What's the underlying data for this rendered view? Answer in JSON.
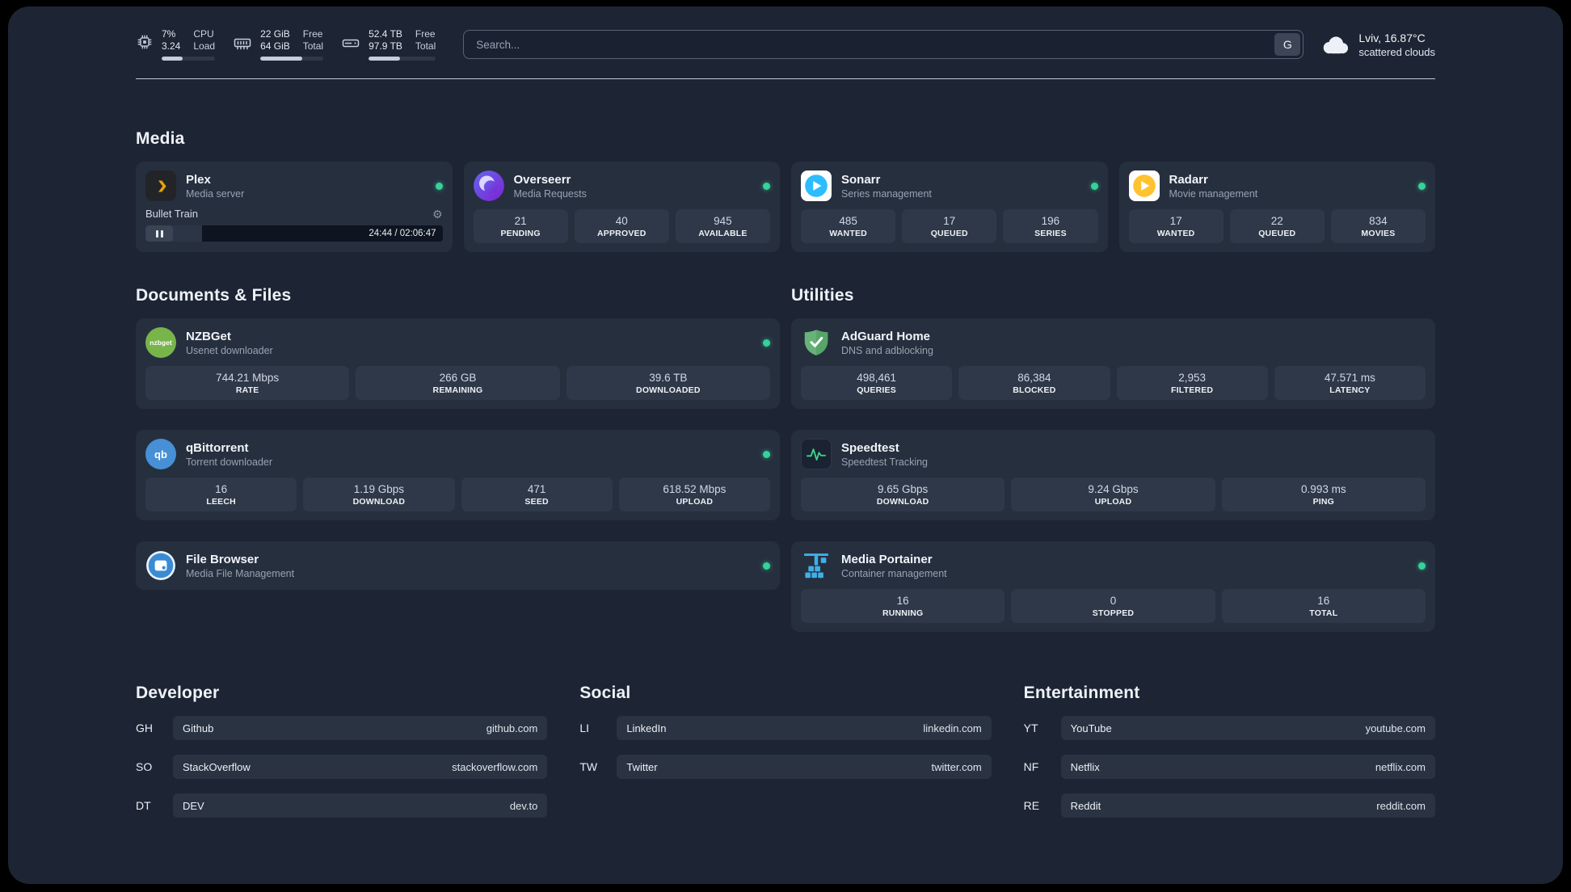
{
  "topbar": {
    "cpu": {
      "value_top": "7%",
      "value_bottom": "3.24",
      "label_top": "CPU",
      "label_bottom": "Load",
      "bar": "40%"
    },
    "memory": {
      "value_top": "22 GiB",
      "value_bottom": "64 GiB",
      "label_top": "Free",
      "label_bottom": "Total",
      "bar": "66%"
    },
    "disk": {
      "value_top": "52.4 TB",
      "value_bottom": "97.9 TB",
      "label_top": "Free",
      "label_bottom": "Total",
      "bar": "47%"
    },
    "search": {
      "placeholder": "Search...",
      "provider_label": "G"
    },
    "weather": {
      "location": "Lviv, 16.87°C",
      "condition": "scattered clouds"
    }
  },
  "sections": {
    "media": {
      "title": "Media",
      "plex": {
        "name": "Plex",
        "subtitle": "Media server",
        "player": {
          "track": "Bullet Train",
          "time": "24:44 / 02:06:47",
          "progress": "19%"
        }
      },
      "overseerr": {
        "name": "Overseerr",
        "subtitle": "Media Requests",
        "stats": [
          {
            "value": "21",
            "label": "PENDING"
          },
          {
            "value": "40",
            "label": "APPROVED"
          },
          {
            "value": "945",
            "label": "AVAILABLE"
          }
        ]
      },
      "sonarr": {
        "name": "Sonarr",
        "subtitle": "Series management",
        "stats": [
          {
            "value": "485",
            "label": "WANTED"
          },
          {
            "value": "17",
            "label": "QUEUED"
          },
          {
            "value": "196",
            "label": "SERIES"
          }
        ]
      },
      "radarr": {
        "name": "Radarr",
        "subtitle": "Movie management",
        "stats": [
          {
            "value": "17",
            "label": "WANTED"
          },
          {
            "value": "22",
            "label": "QUEUED"
          },
          {
            "value": "834",
            "label": "MOVIES"
          }
        ]
      }
    },
    "documents": {
      "title": "Documents & Files",
      "nzbget": {
        "name": "NZBGet",
        "subtitle": "Usenet downloader",
        "stats": [
          {
            "value": "744.21 Mbps",
            "label": "RATE"
          },
          {
            "value": "266 GB",
            "label": "REMAINING"
          },
          {
            "value": "39.6 TB",
            "label": "DOWNLOADED"
          }
        ]
      },
      "qbittorrent": {
        "name": "qBittorrent",
        "subtitle": "Torrent downloader",
        "stats": [
          {
            "value": "16",
            "label": "LEECH"
          },
          {
            "value": "1.19 Gbps",
            "label": "DOWNLOAD"
          },
          {
            "value": "471",
            "label": "SEED"
          },
          {
            "value": "618.52 Mbps",
            "label": "UPLOAD"
          }
        ]
      },
      "filebrowser": {
        "name": "File Browser",
        "subtitle": "Media File Management"
      }
    },
    "utilities": {
      "title": "Utilities",
      "adguard": {
        "name": "AdGuard Home",
        "subtitle": "DNS and adblocking",
        "stats": [
          {
            "value": "498,461",
            "label": "QUERIES"
          },
          {
            "value": "86,384",
            "label": "BLOCKED"
          },
          {
            "value": "2,953",
            "label": "FILTERED"
          },
          {
            "value": "47.571 ms",
            "label": "LATENCY"
          }
        ]
      },
      "speedtest": {
        "name": "Speedtest",
        "subtitle": "Speedtest Tracking",
        "stats": [
          {
            "value": "9.65 Gbps",
            "label": "DOWNLOAD"
          },
          {
            "value": "9.24 Gbps",
            "label": "UPLOAD"
          },
          {
            "value": "0.993 ms",
            "label": "PING"
          }
        ]
      },
      "portainer": {
        "name": "Media Portainer",
        "subtitle": "Container management",
        "stats": [
          {
            "value": "16",
            "label": "RUNNING"
          },
          {
            "value": "0",
            "label": "STOPPED"
          },
          {
            "value": "16",
            "label": "TOTAL"
          }
        ]
      }
    },
    "developer": {
      "title": "Developer",
      "links": [
        {
          "abbr": "GH",
          "name": "Github",
          "url": "github.com"
        },
        {
          "abbr": "SO",
          "name": "StackOverflow",
          "url": "stackoverflow.com"
        },
        {
          "abbr": "DT",
          "name": "DEV",
          "url": "dev.to"
        }
      ]
    },
    "social": {
      "title": "Social",
      "links": [
        {
          "abbr": "LI",
          "name": "LinkedIn",
          "url": "linkedin.com"
        },
        {
          "abbr": "TW",
          "name": "Twitter",
          "url": "twitter.com"
        }
      ]
    },
    "entertainment": {
      "title": "Entertainment",
      "links": [
        {
          "abbr": "YT",
          "name": "YouTube",
          "url": "youtube.com"
        },
        {
          "abbr": "NF",
          "name": "Netflix",
          "url": "netflix.com"
        },
        {
          "abbr": "RE",
          "name": "Reddit",
          "url": "reddit.com"
        }
      ]
    }
  },
  "icons": {
    "gear_glyph": "⚙",
    "nzbget_text": "nzbget",
    "qbittorrent_text": "qb"
  },
  "colors": {
    "status_online": "#34d399",
    "background": "#1d2534",
    "card": "#262f3e",
    "tile": "#2e3848",
    "plex_accent": "#e5a00d",
    "speedtest_accent": "#3dd68c"
  }
}
